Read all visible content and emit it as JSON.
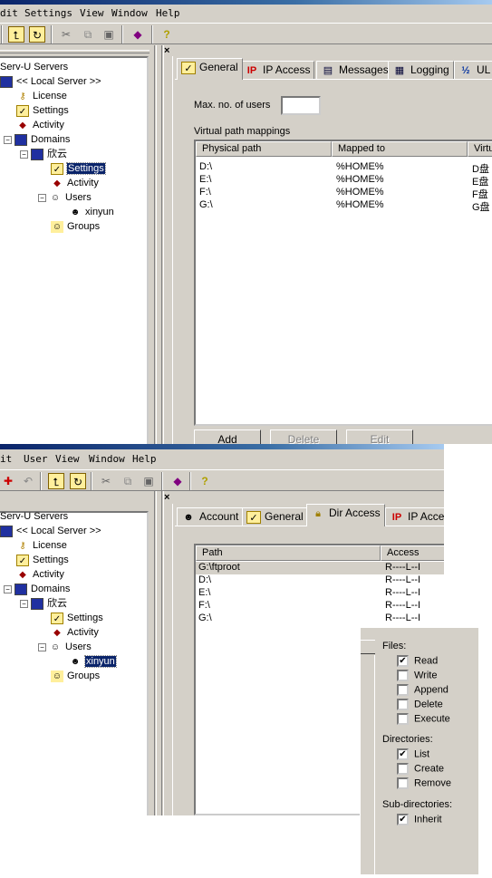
{
  "top": {
    "menu": [
      "dit",
      "Settings",
      "View",
      "Window",
      "Help"
    ],
    "tree": {
      "root": "Serv-U Servers",
      "server": "<< Local Server >>",
      "license": "License",
      "settings": "Settings",
      "activity": "Activity",
      "domains": "Domains",
      "domain": "欣云",
      "d_settings": "Settings",
      "d_activity": "Activity",
      "users": "Users",
      "user": "xinyun",
      "groups": "Groups",
      "selected": "d_settings"
    },
    "close": "×",
    "tabs": [
      "General",
      "IP Access",
      "Messages",
      "Logging",
      "UL"
    ],
    "active_tab": "General",
    "max_users_label": "Max. no. of users",
    "max_users_value": "",
    "vpm_label": "Virtual path mappings",
    "columns": [
      "Physical path",
      "Mapped to",
      "Virtu"
    ],
    "rows": [
      [
        "D:\\",
        "%HOME%",
        "D盘"
      ],
      [
        "E:\\",
        "%HOME%",
        "E盘"
      ],
      [
        "F:\\",
        "%HOME%",
        "F盘"
      ],
      [
        "G:\\",
        "%HOME%",
        "G盘"
      ]
    ],
    "buttons": {
      "add": "Add",
      "delete": "Delete",
      "edit": "Edit"
    }
  },
  "bottom": {
    "menu": [
      "it",
      "User",
      "View",
      "Window",
      "Help"
    ],
    "tree": {
      "root": "Serv-U Servers",
      "server": "<< Local Server >>",
      "license": "License",
      "settings": "Settings",
      "activity": "Activity",
      "domains": "Domains",
      "domain": "欣云",
      "d_settings": "Settings",
      "d_activity": "Activity",
      "users": "Users",
      "user": "xinyun",
      "groups": "Groups",
      "selected": "user"
    },
    "close": "×",
    "tabs": [
      "Account",
      "General",
      "Dir Access",
      "IP Acce"
    ],
    "active_tab": "Dir Access",
    "columns": [
      "Path",
      "Access"
    ],
    "rows": [
      [
        "G:\\ftproot",
        "R----L--I"
      ],
      [
        "D:\\",
        "R----L--I"
      ],
      [
        "E:\\",
        "R----L--I"
      ],
      [
        "F:\\",
        "R----L--I"
      ],
      [
        "G:\\",
        "R----L--I"
      ]
    ],
    "selected_row": 0,
    "perms": {
      "files_label": "Files:",
      "files": [
        {
          "label": "Read",
          "checked": true
        },
        {
          "label": "Write",
          "checked": false
        },
        {
          "label": "Append",
          "checked": false
        },
        {
          "label": "Delete",
          "checked": false
        },
        {
          "label": "Execute",
          "checked": false
        }
      ],
      "dirs_label": "Directories:",
      "dirs": [
        {
          "label": "List",
          "checked": true
        },
        {
          "label": "Create",
          "checked": false
        },
        {
          "label": "Remove",
          "checked": false
        }
      ],
      "sub_label": "Sub-directories:",
      "sub": [
        {
          "label": "Inherit",
          "checked": true
        }
      ]
    }
  }
}
